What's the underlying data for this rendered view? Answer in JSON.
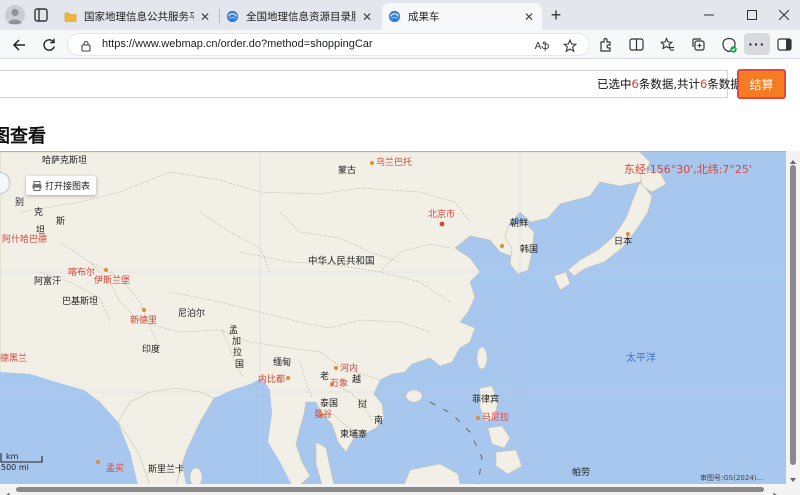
{
  "browser": {
    "tabs": [
      {
        "title": "国家地理信息公共服务平台 天地图",
        "active": false
      },
      {
        "title": "全国地理信息资源目录服务系统",
        "active": false
      },
      {
        "title": "成果车",
        "active": true
      }
    ],
    "url": "https://www.webmap.cn/order.do?method=shoppingCar",
    "icons": [
      "profile-icon",
      "tab-actions-icon",
      "back-icon",
      "refresh-icon",
      "lock-icon",
      "read-aloud-icon",
      "favorite-star-icon",
      "extensions-icon",
      "split-screen-icon",
      "favorites-icon",
      "collections-icon",
      "browser-essentials-icon",
      "more-icon",
      "sidebar-icon"
    ],
    "read_aloud_label": "Aֆ",
    "more_label": "···"
  },
  "cart": {
    "summary_prefix": "已选中",
    "selected_count": "6",
    "summary_middle": "条数据,共计",
    "total_count": "6",
    "summary_suffix": "条数据",
    "checkout_label": "结算",
    "accent_color": "#f57c22"
  },
  "section": {
    "heading": "图查看"
  },
  "map": {
    "coord_readout": "东经:156°30',北纬:7°25'",
    "legend_toggle_label": "打开接图表",
    "scale_km": "km",
    "scale_mi": "500 mi",
    "attribution": "审图号:GS(2024)...",
    "land_color": "#f2efe6",
    "sea_color": "#a8c7ef",
    "labels": {
      "kazakhstan": "哈萨克斯坦",
      "mongolia": "蒙古",
      "ulaanbaatar": "乌兰巴托",
      "beijing": "北京市",
      "north_korea": "朝鲜",
      "south_korea": "韩国",
      "japan": "日本",
      "china": "中华人民共和国",
      "kashgar_part1": "别",
      "kyrgyz": "克",
      "tajik": "斯",
      "dushanbe": "坦",
      "uzbek_part": "阿什哈巴德",
      "kabul": "喀布尔",
      "islamabad": "伊斯兰堡",
      "afghanistan": "阿富汗",
      "pakistan": "巴基斯坦",
      "new_delhi": "新德里",
      "nepal": "尼泊尔",
      "india": "印度",
      "bangladesh_a": "孟",
      "bangladesh_b": "加",
      "bangladesh_c": "拉",
      "bangladesh_d": "国",
      "myanmar": "缅甸",
      "hanoi": "河内",
      "laos_a": "老",
      "laos_b": "挝",
      "vientiane": "万象",
      "naypyidaw": "内比都",
      "vietnam_a": "越",
      "vietnam_b": "南",
      "thailand": "泰国",
      "bangkok": "曼谷",
      "cambodia": "柬埔寨",
      "philippines": "菲律宾",
      "manila": "马尼拉",
      "pacific": "太平洋",
      "mumbai": "孟买",
      "sri_lanka": "斯里兰卡",
      "palau": "帕劳",
      "west_label": "德黑兰"
    }
  }
}
